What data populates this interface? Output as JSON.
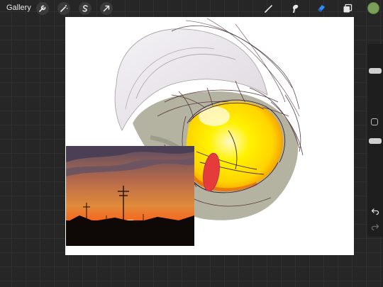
{
  "topbar": {
    "gallery_label": "Gallery",
    "left_tools": [
      {
        "name": "wrench-icon"
      },
      {
        "name": "magic-wand-icon"
      },
      {
        "name": "selection-s-icon"
      },
      {
        "name": "transform-arrow-icon"
      }
    ],
    "right_tools": [
      {
        "name": "brush-icon"
      },
      {
        "name": "smudge-icon"
      },
      {
        "name": "eraser-icon",
        "active": true
      },
      {
        "name": "layers-icon"
      }
    ],
    "current_color": "#7aa05a"
  },
  "sidebar": {
    "items": [
      "brush-size-slider",
      "modify-button",
      "opacity-slider",
      "undo-icon",
      "redo-icon"
    ]
  },
  "colors": {
    "accent_active": "#2f8cff",
    "canvas": "#ffffff",
    "workspace": "#262626"
  }
}
